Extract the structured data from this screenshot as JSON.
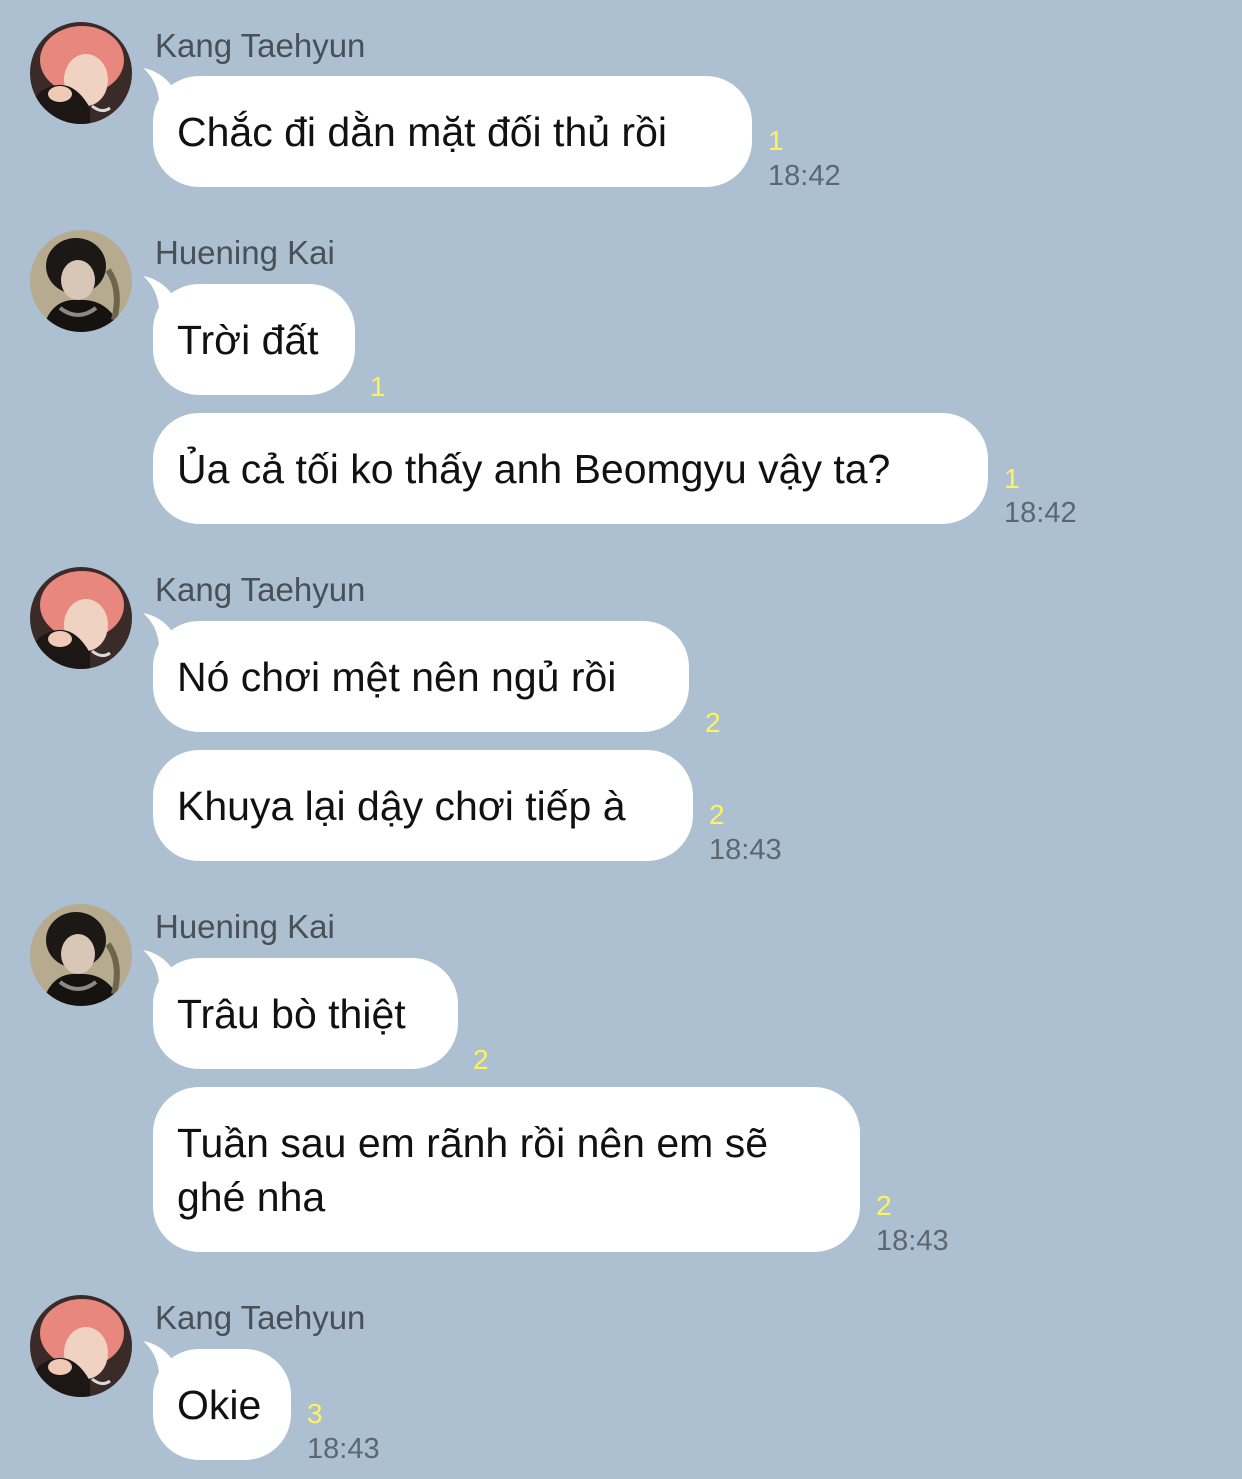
{
  "colors": {
    "background": "#adc0d1",
    "bubble": "#ffffff",
    "read_count": "#fff35a",
    "timestamp": "#5e6670",
    "sender_name": "#4a5058"
  },
  "messages": [
    {
      "sender": "Kang Taehyun",
      "text": "Chắc đi dằn mặt đối thủ rồi",
      "read": "1",
      "time": "18:42"
    },
    {
      "sender": "Huening Kai",
      "text": "Trời đất",
      "read": "1"
    },
    {
      "text": "Ủa cả tối ko thấy anh Beomgyu vậy ta?",
      "read": "1",
      "time": "18:42"
    },
    {
      "sender": "Kang Taehyun",
      "text": "Nó chơi mệt nên ngủ rồi",
      "read": "2"
    },
    {
      "text": "Khuya lại dậy chơi tiếp à",
      "read": "2",
      "time": "18:43"
    },
    {
      "sender": "Huening Kai",
      "text": "Trâu bò thiệt",
      "read": "2"
    },
    {
      "text": "Tuần sau em rãnh rồi nên em sẽ ghé nha",
      "read": "2",
      "time": "18:43"
    },
    {
      "sender": "Kang Taehyun",
      "text": "Okie",
      "read": "3",
      "time": "18:43"
    }
  ]
}
